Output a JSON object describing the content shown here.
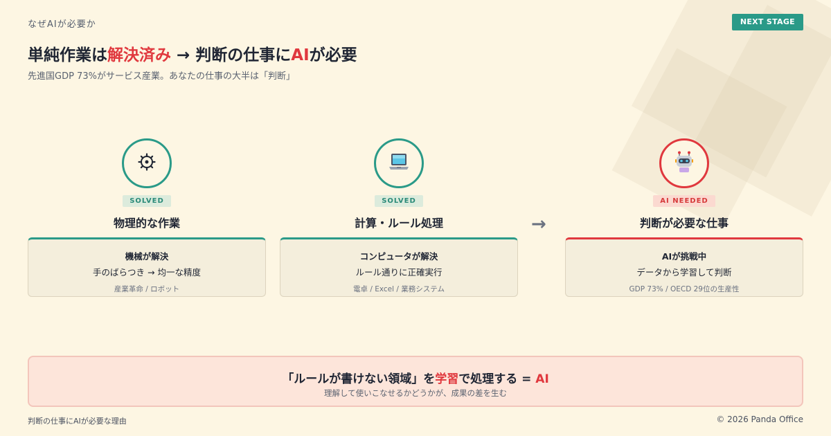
{
  "header": {
    "eyebrow": "なぜAIが必要か",
    "next_button": "NEXT STAGE",
    "title_part1": "単純作業は",
    "title_hl1": "解決済み",
    "title_part2": " → 判断の仕事に",
    "title_hl2": "AI",
    "title_part3": "が必要",
    "subtitle": "先進国GDP 73%がサービス産業。あなたの仕事の大半は「判断」"
  },
  "columns": [
    {
      "icon": "gear-icon",
      "badge": "SOLVED",
      "title": "物理的な作業",
      "line1": "機械が解決",
      "line2": "手のばらつき → 均一な精度",
      "line3": "産業革命 / ロボット"
    },
    {
      "icon": "laptop-icon",
      "badge": "SOLVED",
      "title": "計算・ルール処理",
      "line1": "コンピュータが解決",
      "line2": "ルール通りに正確実行",
      "line3": "電卓 / Excel / 業務システム"
    },
    {
      "icon": "robot-icon",
      "badge": "AI NEEDED",
      "title": "判断が必要な仕事",
      "line1": "AIが挑戦中",
      "line2": "データから学習して判断",
      "line3": "GDP 73% / OECD 29位の生産性"
    }
  ],
  "arrow": "→",
  "banner": {
    "part1": "「ルールが書けない領域」を",
    "hl1": "学習",
    "part2": "で処理する = ",
    "hl2": "AI",
    "sub": "理解して使いこなせるかどうかが、成果の差を生む"
  },
  "footer": {
    "left": "判断の仕事にAIが必要な理由",
    "right": "© 2026 Panda Office"
  },
  "colors": {
    "accent_green": "#2a9a88",
    "accent_red": "#e0383e",
    "background": "#fdf6e3"
  }
}
